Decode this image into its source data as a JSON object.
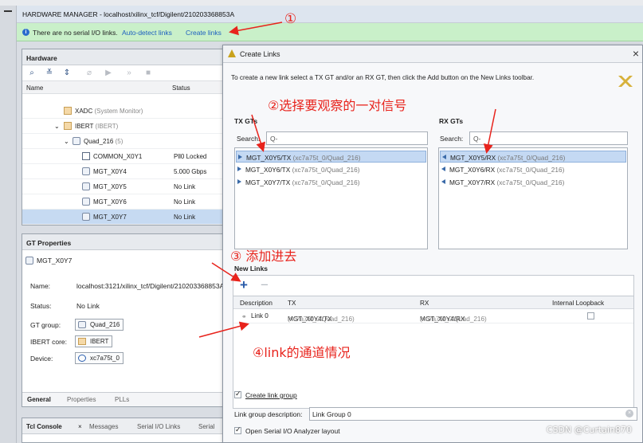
{
  "window": {
    "title": "HARDWARE MANAGER - localhost/xilinx_tcf/Digilent/210203368853A"
  },
  "infobar": {
    "message": "There are no serial I/O links.",
    "auto_detect": "Auto-detect links",
    "create": "Create links"
  },
  "hardware_panel": {
    "title": "Hardware",
    "columns": [
      "Name",
      "Status"
    ],
    "rows": [
      {
        "name": "XADC",
        "suffix": "(System Monitor)",
        "status": ""
      },
      {
        "name": "IBERT",
        "suffix": "(IBERT)",
        "status": ""
      },
      {
        "name": "Quad_216",
        "suffix": "(5)",
        "status": ""
      },
      {
        "name": "COMMON_X0Y1",
        "suffix": "",
        "status": "Pll0 Locked"
      },
      {
        "name": "MGT_X0Y4",
        "suffix": "",
        "status": "5.000 Gbps"
      },
      {
        "name": "MGT_X0Y5",
        "suffix": "",
        "status": "No Link"
      },
      {
        "name": "MGT_X0Y6",
        "suffix": "",
        "status": "No Link"
      },
      {
        "name": "MGT_X0Y7",
        "suffix": "",
        "status": "No Link"
      }
    ]
  },
  "gt_properties": {
    "title": "GT Properties",
    "object": "MGT_X0Y7",
    "name_label": "Name:",
    "name_value": "localhost:3121/xilinx_tcf/Digilent/210203368853A",
    "status_label": "Status:",
    "status_value": "No Link",
    "group_label": "GT group:",
    "group_value": "Quad_216",
    "ibert_label": "IBERT core:",
    "ibert_value": "IBERT",
    "device_label": "Device:",
    "device_value": "xc7a75t_0",
    "tabs": [
      "General",
      "Properties",
      "PLLs"
    ]
  },
  "tcl_panel": {
    "tabs": [
      "Tcl Console",
      "Messages",
      "Serial I/O Links",
      "Serial"
    ]
  },
  "dialog": {
    "title": "Create Links",
    "instructions": "To create a new link select a TX GT and/or an RX GT, then click the Add button on the New Links toolbar.",
    "tx_label": "TX GTs",
    "rx_label": "RX GTs",
    "search_label": "Search:",
    "search_placeholder": "Q-",
    "tx_items": [
      {
        "name": "MGT_X0Y5/TX",
        "path": "(xc7a75t_0/Quad_216)"
      },
      {
        "name": "MGT_X0Y6/TX",
        "path": "(xc7a75t_0/Quad_216)"
      },
      {
        "name": "MGT_X0Y7/TX",
        "path": "(xc7a75t_0/Quad_216)"
      }
    ],
    "rx_items": [
      {
        "name": "MGT_X0Y5/RX",
        "path": "(xc7a75t_0/Quad_216)"
      },
      {
        "name": "MGT_X0Y6/RX",
        "path": "(xc7a75t_0/Quad_216)"
      },
      {
        "name": "MGT_X0Y7/RX",
        "path": "(xc7a75t_0/Quad_216)"
      }
    ],
    "new_links_label": "New Links",
    "link_columns": [
      "Description",
      "TX",
      "RX",
      "Internal Loopback"
    ],
    "link_row": {
      "desc": "Link 0",
      "tx": "MGT_X0Y4/TX",
      "tx_path": "(xc7a75t_0/Quad_216)",
      "rx": "MGT_X0Y4/RX",
      "rx_path": "(xc7a75t_0/Quad_216)"
    },
    "create_group": "Create link group",
    "group_desc_label": "Link group description:",
    "group_desc_value": "Link Group 0",
    "open_analyzer": "Open Serial I/O Analyzer layout"
  },
  "annotations": {
    "n1": "①",
    "n2": "②选择要观察的一对信号",
    "n3": "③ 添加进去",
    "n4": "④link的通道情况",
    "color": "#e8231c"
  },
  "watermark": "CSDN @Curtain870"
}
